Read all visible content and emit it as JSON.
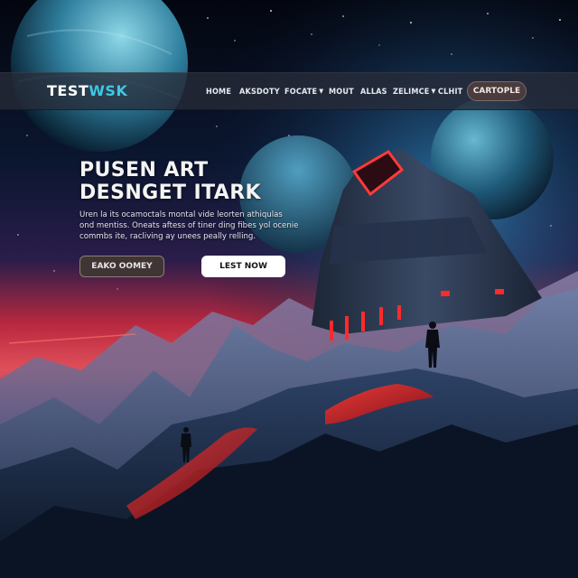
{
  "brand": {
    "part1": "TEST",
    "part2": "WSK"
  },
  "nav": {
    "items": [
      {
        "label": "HOME",
        "dropdown": false
      },
      {
        "label": "AKSDOTY",
        "dropdown": false
      },
      {
        "label": "FOCATE",
        "dropdown": true
      },
      {
        "label": "MOUT",
        "dropdown": false
      },
      {
        "label": "ALLAS",
        "dropdown": false
      },
      {
        "label": "ZELIMCE",
        "dropdown": true
      },
      {
        "label": "CLHIT",
        "dropdown": false
      }
    ],
    "cta_label": "CARTOPLE"
  },
  "hero": {
    "title_line1": "PUSEN ART",
    "title_line2": "DESNGET ITARK",
    "description_lines": [
      "Uren la its ocamoctals montal vide leorten athiqulas",
      "ond mentiss. Oneats aftess of tiner ding fibes yol ocenie",
      "commbs ite, racliving ay unees peally relling."
    ],
    "button_secondary_label": "EAKO OOMEY",
    "button_primary_label": "LEST NOW"
  },
  "colors": {
    "brand_accent": "#3fc7e6",
    "nav_background": "#282c38",
    "cta_background": "#4a3b3c",
    "glow_red": "#ff2a2a",
    "sky_top": "#050914",
    "sky_horizon": "#e0324a"
  }
}
